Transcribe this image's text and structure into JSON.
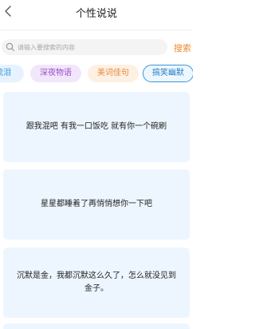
{
  "header": {
    "title": "个性说说"
  },
  "search": {
    "placeholder": "请输入要搜索的内容",
    "button_label": "搜索"
  },
  "tabs": [
    {
      "label": "伤感流泪",
      "shown": "流泪",
      "selected": false
    },
    {
      "label": "深夜物语",
      "selected": false
    },
    {
      "label": "美词佳句",
      "selected": false
    },
    {
      "label": "搞笑幽默",
      "selected": true
    }
  ],
  "cards": [
    {
      "text": "跟我混吧 有我一口饭吃 就有你一个碗刷"
    },
    {
      "text": "星星都睡着了再悄悄想你一下吧"
    },
    {
      "text": "沉默是金，我都沉默这么久了，怎么就没见到金子。"
    },
    {
      "text": ""
    }
  ],
  "colors": {
    "accent": "#f08a2a",
    "card_bg": "#edf6fe",
    "selected_tab_border": "#3b95d6"
  },
  "icons": {
    "back": "chevron-left-icon",
    "search": "search-icon"
  }
}
